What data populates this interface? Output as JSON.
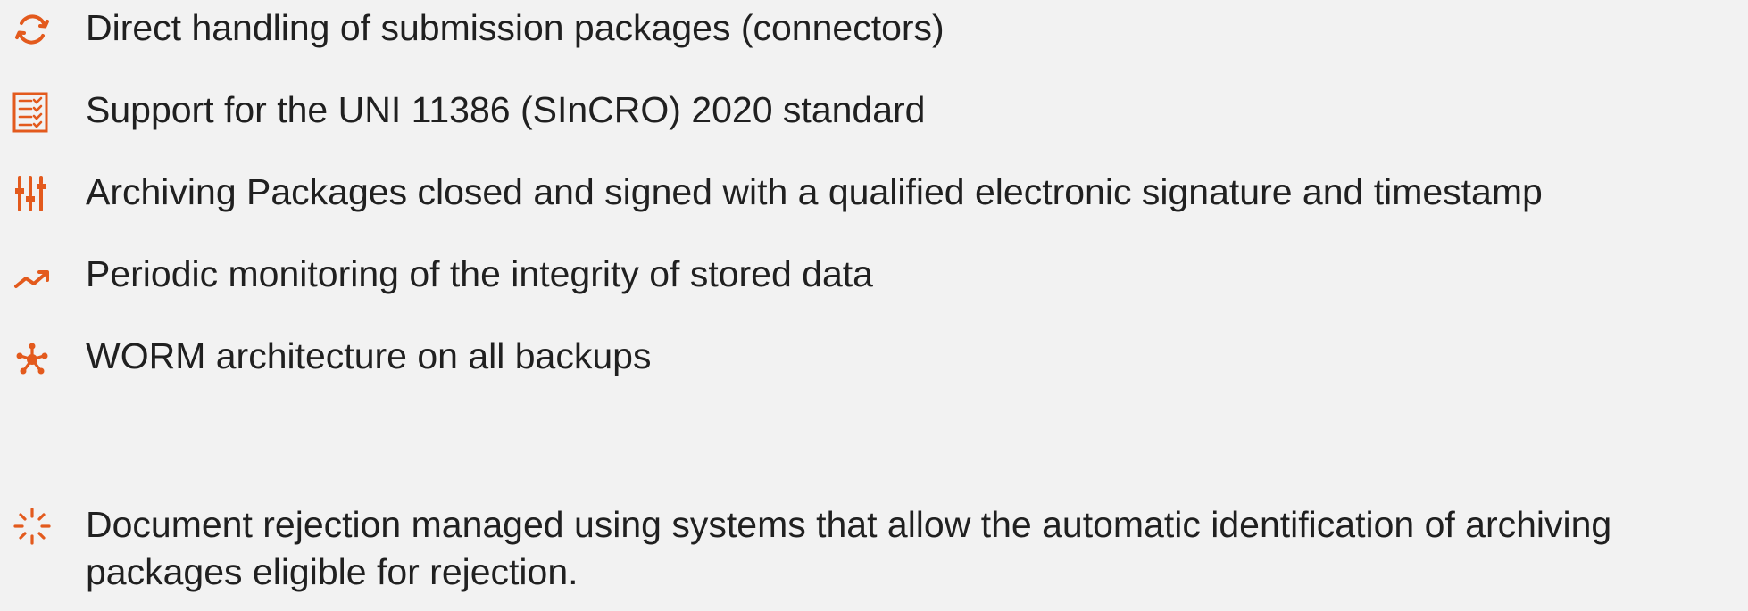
{
  "accent_color": "#e35a1d",
  "features": [
    {
      "icon": "sync-icon",
      "text": "Direct handling of submission packages (connectors)"
    },
    {
      "icon": "checklist-icon",
      "text": "Support for the UNI 11386 (SInCRO) 2020 standard"
    },
    {
      "icon": "sliders-icon",
      "text": "Archiving Packages closed and signed with a qualified electronic signature and timestamp"
    },
    {
      "icon": "trend-up-icon",
      "text": "Periodic monitoring of the integrity of stored data"
    },
    {
      "icon": "network-hub-icon",
      "text": "WORM architecture on all backups"
    },
    {
      "icon": "loading-burst-icon",
      "text": "Document rejection managed using systems that allow the automatic identification of archiving packages eligible for rejection."
    }
  ]
}
